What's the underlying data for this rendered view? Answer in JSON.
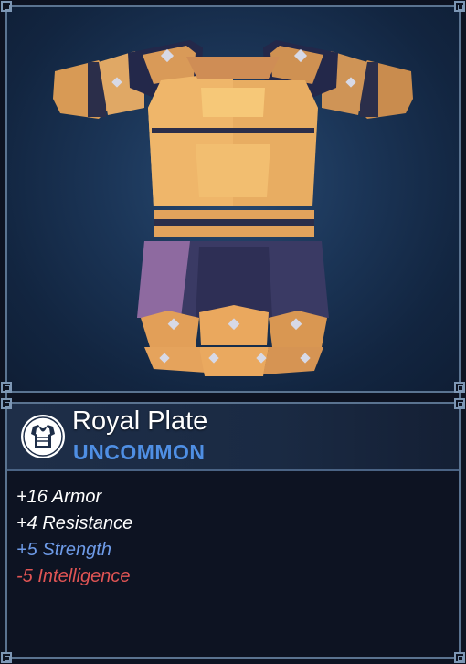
{
  "item": {
    "name": "Royal Plate",
    "rarity": "UNCOMMON",
    "slot_icon": "chest-armor-icon",
    "art_icon": "royal-plate-armor-icon"
  },
  "stats": [
    {
      "text": "+16 Armor",
      "color": "#ffffff"
    },
    {
      "text": "+4 Resistance",
      "color": "#ffffff"
    },
    {
      "text": "+5 Strength",
      "color": "#6e9be8"
    },
    {
      "text": "-5 Intelligence",
      "color": "#e05454"
    }
  ],
  "colors": {
    "frame": "#5a7390",
    "background": "#0d1322",
    "rarity": "#4f8fe4",
    "positive_stat": "#6e9be8",
    "negative_stat": "#e05454"
  }
}
